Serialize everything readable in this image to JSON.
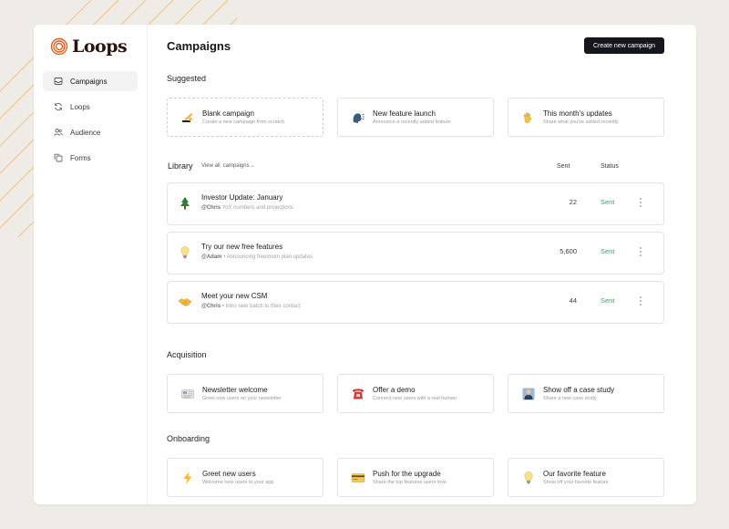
{
  "brand": {
    "name": "Loops",
    "accent": "#e2611c",
    "status_sent_color": "#22b068"
  },
  "sidebar": {
    "items": [
      {
        "label": "Campaigns",
        "icon": "inbox-icon",
        "active": true
      },
      {
        "label": "Loops",
        "icon": "refresh-icon",
        "active": false
      },
      {
        "label": "Audience",
        "icon": "users-icon",
        "active": false
      },
      {
        "label": "Forms",
        "icon": "copy-icon",
        "active": false
      }
    ]
  },
  "header": {
    "title": "Campaigns",
    "create_button": "Create new campaign"
  },
  "suggested": {
    "title": "Suggested",
    "cards": [
      {
        "title": "Blank campaign",
        "subtitle": "Create a new campaign from scratch",
        "icon": "writing-hand-icon"
      },
      {
        "title": "New feature launch",
        "subtitle": "Announce a recently added feature",
        "icon": "speaking-head-icon"
      },
      {
        "title": "This month's updates",
        "subtitle": "Share what you've added recently",
        "icon": "waving-hand-icon"
      }
    ]
  },
  "library": {
    "title": "Library",
    "view_all_prefix": "View all",
    "view_all_label": "campaigns",
    "view_all_arrow": "→",
    "col_sent": "Sent",
    "col_status": "Status",
    "rows": [
      {
        "title": "Investor Update: January",
        "handle": "@Chris",
        "sep": "",
        "desc": "YoY numbers and projections",
        "sent": "22",
        "status": "Sent",
        "icon": "tree-icon"
      },
      {
        "title": "Try our new free features",
        "handle": "@Adam",
        "sep": "•",
        "desc": "Announcing freemium plan updates",
        "sent": "5,600",
        "status": "Sent",
        "icon": "lightbulb-icon"
      },
      {
        "title": "Meet your new CSM",
        "handle": "@Chris",
        "sep": "•",
        "desc": "Intro new batch to their contact",
        "sent": "44",
        "status": "Sent",
        "icon": "handshake-icon"
      }
    ]
  },
  "acquisition": {
    "title": "Acquisition",
    "cards": [
      {
        "title": "Newsletter welcome",
        "subtitle": "Greet new users on your newsletter",
        "icon": "newspaper-icon"
      },
      {
        "title": "Offer a demo",
        "subtitle": "Connect new users with a real human",
        "icon": "telephone-icon"
      },
      {
        "title": "Show off a case study",
        "subtitle": "Share a new case study",
        "icon": "person-in-suit-icon"
      }
    ]
  },
  "onboarding": {
    "title": "Onboarding",
    "cards": [
      {
        "title": "Greet new users",
        "subtitle": "Welcome new users to your app",
        "icon": "lightning-icon"
      },
      {
        "title": "Push for the upgrade",
        "subtitle": "Share the top features users love",
        "icon": "credit-card-icon"
      },
      {
        "title": "Our favorite feature",
        "subtitle": "Show off your favorite feature",
        "icon": "lightbulb-icon"
      }
    ]
  }
}
